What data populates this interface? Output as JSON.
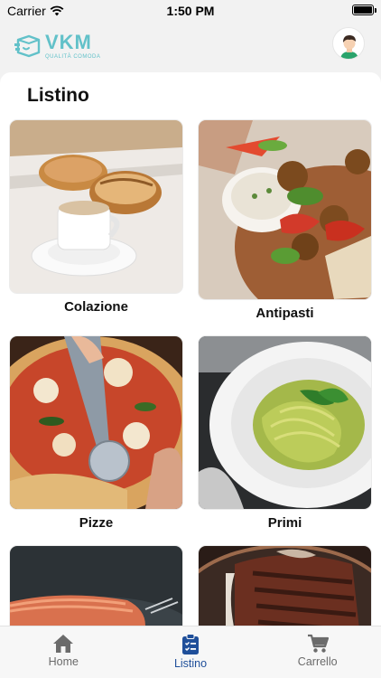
{
  "status_bar": {
    "carrier": "Carrier",
    "time": "1:50 PM"
  },
  "header": {
    "logo_name": "VKM",
    "logo_tagline": "QUALITÀ COMODA"
  },
  "page": {
    "title": "Listino"
  },
  "categories": [
    {
      "label": "Colazione"
    },
    {
      "label": "Antipasti"
    },
    {
      "label": "Pizze"
    },
    {
      "label": "Primi"
    },
    {
      "label": ""
    },
    {
      "label": ""
    }
  ],
  "tab_bar": {
    "items": [
      {
        "label": "Home",
        "icon": "home-icon"
      },
      {
        "label": "Listino",
        "icon": "clipboard-list-icon",
        "active": true
      },
      {
        "label": "Carrello",
        "icon": "cart-icon"
      }
    ]
  },
  "colors": {
    "accent": "#1f4f9a",
    "brand": "#62c1c9",
    "inactive": "#6b6b6b"
  }
}
